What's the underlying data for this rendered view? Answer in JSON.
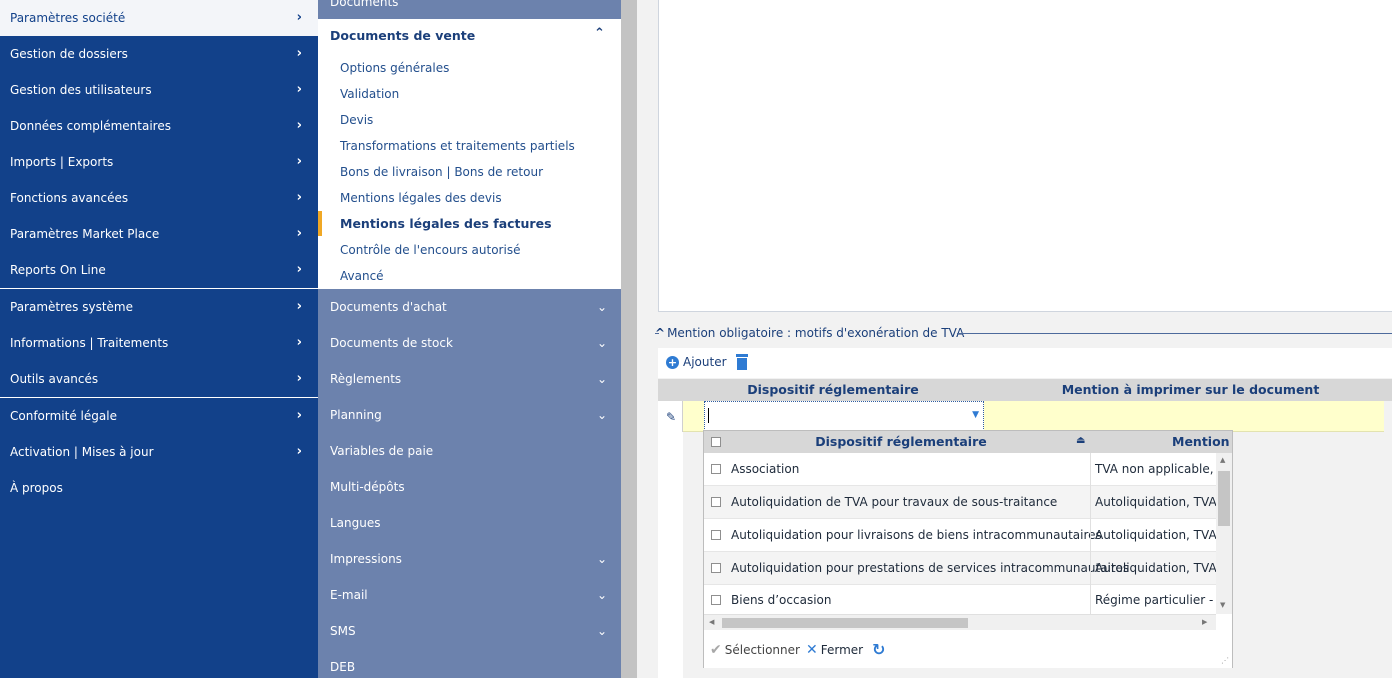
{
  "sidebar": {
    "items": [
      {
        "label": "Paramètres société"
      },
      {
        "label": "Gestion de dossiers"
      },
      {
        "label": "Gestion des utilisateurs"
      },
      {
        "label": "Données complémentaires"
      },
      {
        "label": "Imports | Exports"
      },
      {
        "label": "Fonctions avancées"
      },
      {
        "label": "Paramètres Market Place"
      },
      {
        "label": "Reports On Line"
      },
      {
        "label": "Paramètres système"
      },
      {
        "label": "Informations | Traitements"
      },
      {
        "label": "Outils avancés"
      },
      {
        "label": "Conformité légale"
      },
      {
        "label": "Activation | Mises à jour"
      },
      {
        "label": "À propos"
      }
    ]
  },
  "submenu": {
    "top_cut": "Documents",
    "open_group": "Documents de vente",
    "subitems": [
      "Options générales",
      "Validation",
      "Devis",
      "Transformations et traitements partiels",
      "Bons de livraison | Bons de retour",
      "Mentions légales des devis",
      "Mentions légales des factures",
      "Contrôle de l'encours autorisé",
      "Avancé"
    ],
    "groups": [
      "Documents d'achat",
      "Documents de stock",
      "Règlements",
      "Planning",
      "Variables de paie",
      "Multi-dépôts",
      "Langues",
      "Impressions",
      "E-mail",
      "SMS",
      "DEB"
    ]
  },
  "section": {
    "title": "Mention obligatoire : motifs d'exonération de TVA"
  },
  "toolbar": {
    "add_label": "Ajouter"
  },
  "grid": {
    "columns": [
      "Dispositif réglementaire",
      "Mention à imprimer sur le document"
    ]
  },
  "popup": {
    "columns": [
      "Dispositif réglementaire",
      "Mention à"
    ],
    "rows": [
      {
        "dispositif": "Association",
        "mention": "TVA non applicable, a"
      },
      {
        "dispositif": "Autoliquidation de TVA pour travaux de sous-traitance",
        "mention": "Autoliquidation, TVA d"
      },
      {
        "dispositif": "Autoliquidation pour livraisons de biens intracommunautaires",
        "mention": "Autoliquidation, TVA d"
      },
      {
        "dispositif": "Autoliquidation pour prestations de services intracommunautaires",
        "mention": "Autoliquidation, TVA d"
      },
      {
        "dispositif": "Biens d’occasion",
        "mention": "Régime particulier - Bie"
      }
    ],
    "select_label": "Sélectionner",
    "close_label": "Fermer"
  },
  "colors": {
    "sidebar_bg": "#12418a",
    "submenu_bg": "#6c82ad",
    "accent": "#2f7bd3",
    "selection_marker": "#f0a825",
    "edit_row_bg": "#ffffcc"
  }
}
